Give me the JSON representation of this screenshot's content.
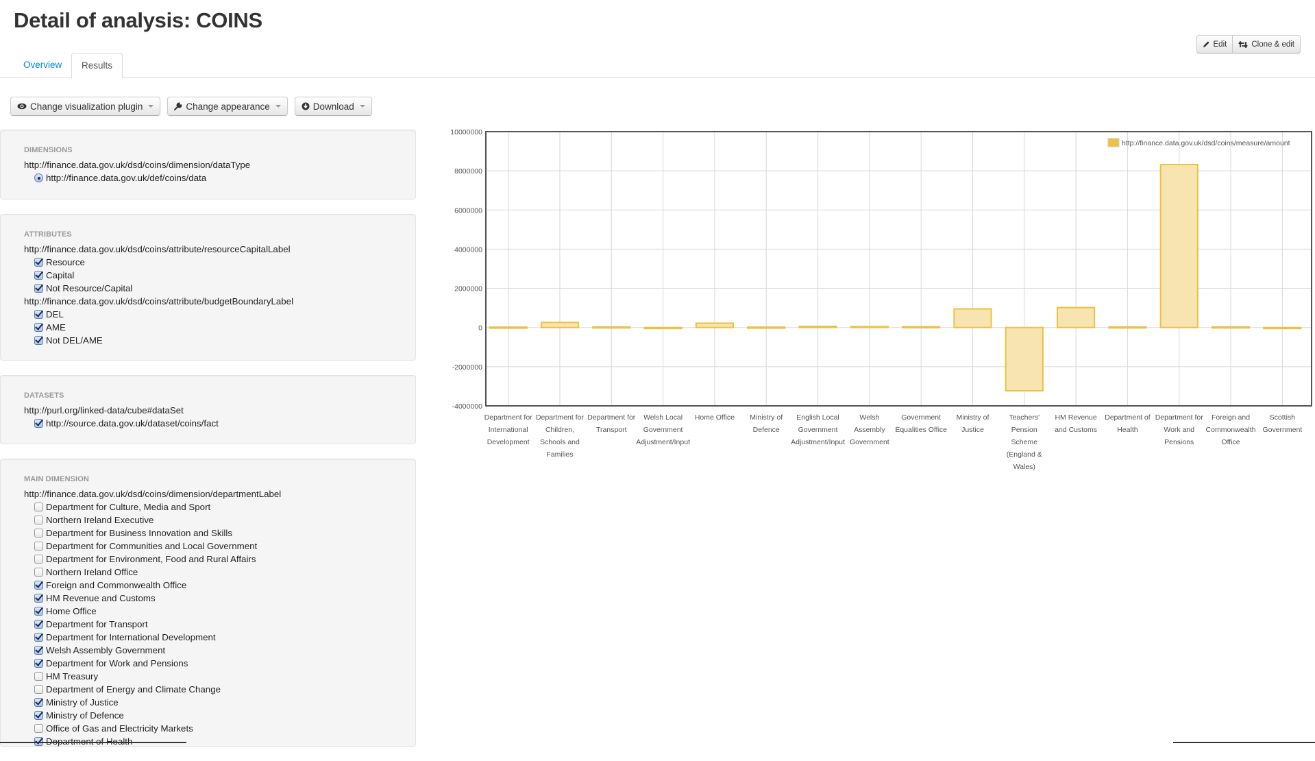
{
  "page": {
    "title": "Detail of analysis: COINS"
  },
  "tabs": [
    {
      "label": "Overview",
      "active": false
    },
    {
      "label": "Results",
      "active": true
    }
  ],
  "actions": {
    "edit_label": "Edit",
    "clone_label": "Clone & edit"
  },
  "toolbar": {
    "visualization_label": "Change visualization plugin",
    "appearance_label": "Change appearance",
    "download_label": "Download"
  },
  "sidebar": {
    "dimensions": {
      "title": "DIMENSIONS",
      "property": "http://finance.data.gov.uk/dsd/coins/dimension/dataType",
      "options": [
        {
          "label": "http://finance.data.gov.uk/def/coins/data",
          "selected": true
        }
      ]
    },
    "attributes": {
      "title": "ATTRIBUTES",
      "groups": [
        {
          "property": "http://finance.data.gov.uk/dsd/coins/attribute/resourceCapitalLabel",
          "options": [
            {
              "label": "Resource",
              "checked": true
            },
            {
              "label": "Capital",
              "checked": true
            },
            {
              "label": "Not Resource/Capital",
              "checked": true
            }
          ]
        },
        {
          "property": "http://finance.data.gov.uk/dsd/coins/attribute/budgetBoundaryLabel",
          "options": [
            {
              "label": "DEL",
              "checked": true
            },
            {
              "label": "AME",
              "checked": true
            },
            {
              "label": "Not DEL/AME",
              "checked": true
            }
          ]
        }
      ]
    },
    "datasets": {
      "title": "DATASETS",
      "property": "http://purl.org/linked-data/cube#dataSet",
      "options": [
        {
          "label": "http://source.data.gov.uk/dataset/coins/fact",
          "checked": true
        }
      ]
    },
    "main_dimension": {
      "title": "MAIN DIMENSION",
      "property": "http://finance.data.gov.uk/dsd/coins/dimension/departmentLabel",
      "options": [
        {
          "label": "Department for Culture, Media and Sport",
          "checked": false
        },
        {
          "label": "Northern Ireland Executive",
          "checked": false
        },
        {
          "label": "Department for Business Innovation and Skills",
          "checked": false
        },
        {
          "label": "Department for Communities and Local Government",
          "checked": false
        },
        {
          "label": "Department for Environment, Food and Rural Affairs",
          "checked": false
        },
        {
          "label": "Northern Ireland Office",
          "checked": false
        },
        {
          "label": "Foreign and Commonwealth Office",
          "checked": true
        },
        {
          "label": "HM Revenue and Customs",
          "checked": true
        },
        {
          "label": "Home Office",
          "checked": true
        },
        {
          "label": "Department for Transport",
          "checked": true
        },
        {
          "label": "Department for International Development",
          "checked": true
        },
        {
          "label": "Welsh Assembly Government",
          "checked": true
        },
        {
          "label": "Department for Work and Pensions",
          "checked": true
        },
        {
          "label": "HM Treasury",
          "checked": false
        },
        {
          "label": "Department of Energy and Climate Change",
          "checked": false
        },
        {
          "label": "Ministry of Justice",
          "checked": true
        },
        {
          "label": "Ministry of Defence",
          "checked": true
        },
        {
          "label": "Office of Gas and Electricity Markets",
          "checked": false
        },
        {
          "label": "Department of Health",
          "checked": true
        }
      ]
    }
  },
  "colors": {
    "bar_fill": "#f7e4b0",
    "bar_stroke": "#edc240",
    "axis": "#545454",
    "grid": "#d8d8d8"
  },
  "chart_data": {
    "type": "bar",
    "title": "",
    "xlabel": "",
    "ylabel": "",
    "ylim": [
      -4000000,
      10000000
    ],
    "yticks": [
      "10000000",
      "8000000",
      "6000000",
      "4000000",
      "2000000",
      "0",
      "-2000000",
      "-4000000"
    ],
    "ytick_values": [
      10000000,
      8000000,
      6000000,
      4000000,
      2000000,
      0,
      -2000000,
      -4000000
    ],
    "grid": true,
    "legend": {
      "position": "top-right",
      "entries": [
        "http://finance.data.gov.uk/dsd/coins/measure/amount"
      ]
    },
    "categories": [
      [
        "Department for",
        "International",
        "Development"
      ],
      [
        "Department for",
        "Children,",
        "Schools and",
        "Families"
      ],
      [
        "Department for",
        "Transport"
      ],
      [
        "Welsh Local",
        "Government",
        "Adjustment/Input"
      ],
      [
        "Home Office"
      ],
      [
        "Ministry of",
        "Defence"
      ],
      [
        "English Local",
        "Government",
        "Adjustment/Input"
      ],
      [
        "Welsh",
        "Assembly",
        "Government"
      ],
      [
        "Government",
        "Equalities Office"
      ],
      [
        "Ministry of",
        "Justice"
      ],
      [
        "Teachers'",
        "Pension",
        "Scheme",
        "(England &",
        "Wales)"
      ],
      [
        "HM Revenue",
        "and Customs"
      ],
      [
        "Department of",
        "Health"
      ],
      [
        "Department for",
        "Work and",
        "Pensions"
      ],
      [
        "Foreign and",
        "Commonwealth",
        "Office"
      ],
      [
        "Scottish",
        "Government"
      ]
    ],
    "series": [
      {
        "name": "http://finance.data.gov.uk/dsd/coins/measure/amount",
        "values": [
          20000,
          260000,
          30000,
          -20000,
          220000,
          20000,
          60000,
          50000,
          40000,
          950000,
          -3230000,
          1020000,
          30000,
          8320000,
          30000,
          -20000
        ]
      }
    ]
  }
}
